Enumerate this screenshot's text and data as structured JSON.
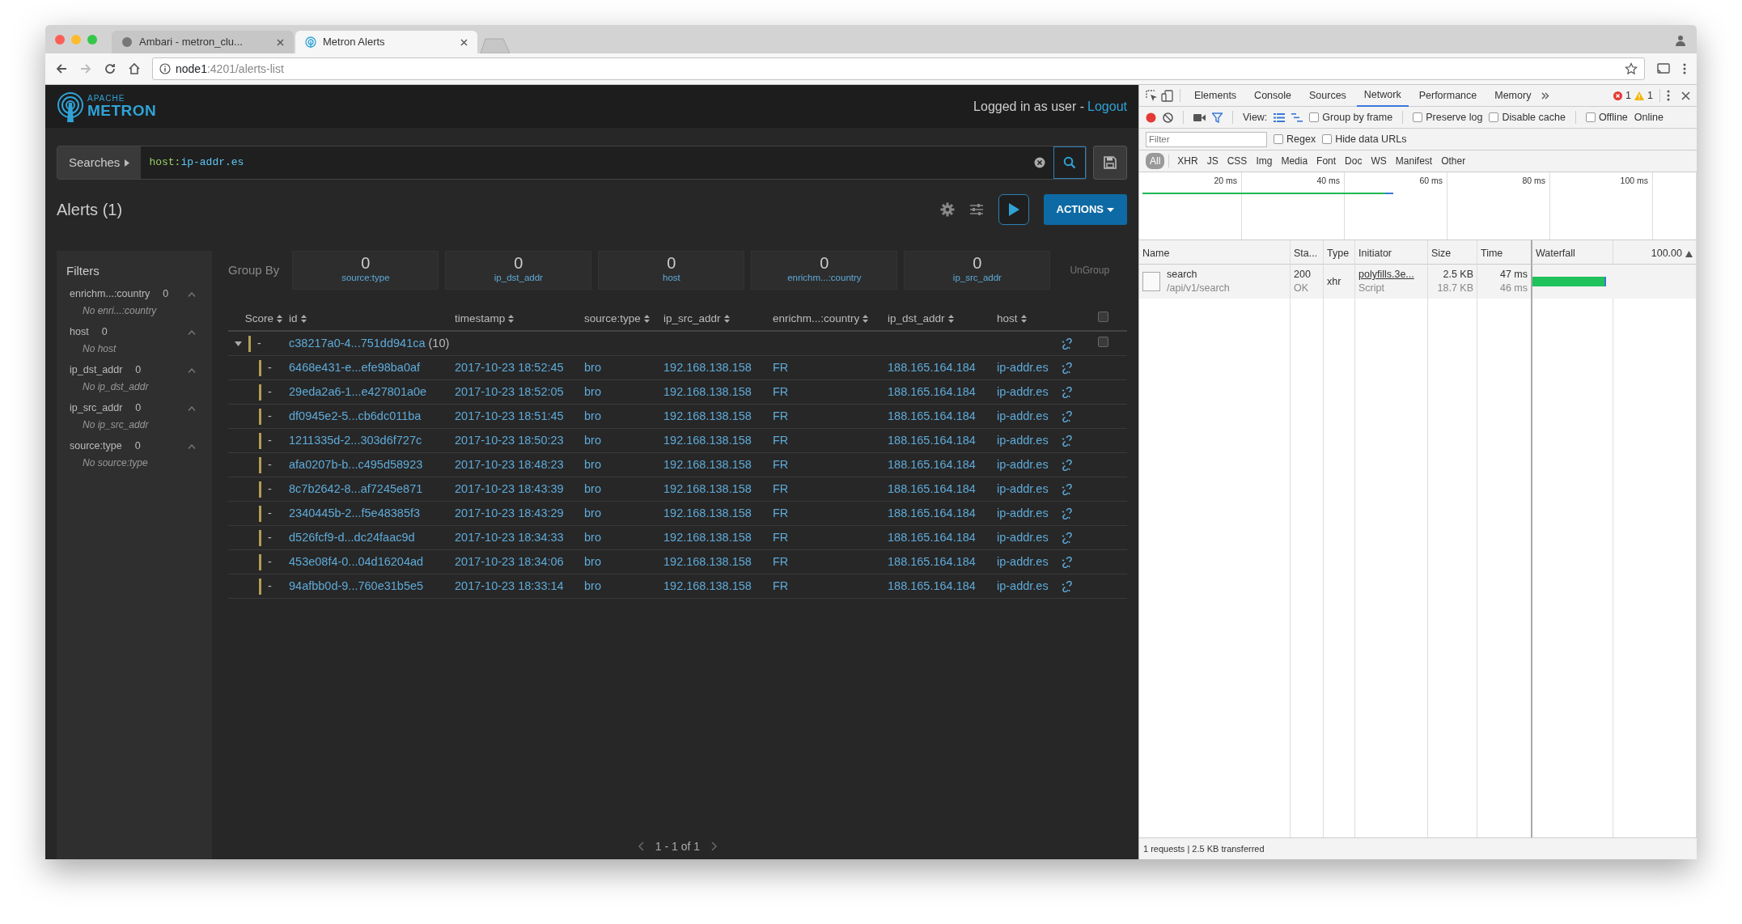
{
  "browser": {
    "tabs": [
      {
        "title": "Ambari - metron_clu...",
        "selected": false
      },
      {
        "title": "Metron Alerts",
        "selected": true
      }
    ],
    "url_host": "node1",
    "url_path": ":4201/alerts-list"
  },
  "app": {
    "logo_small": "APACHE",
    "logo_main": "METRON",
    "login_text": "Logged in as user -",
    "logout": "Logout",
    "searches": "Searches",
    "query_key": "host:",
    "query_value": "ip-addr.es",
    "title": "Alerts (1)",
    "actions": "ACTIONS"
  },
  "filters": {
    "title": "Filters",
    "items": [
      {
        "label": "enrichm...:country",
        "count": "0",
        "empty": "No enri...:country",
        "expanded": true
      },
      {
        "label": "host",
        "count": "0",
        "empty": "No host",
        "expanded": true
      },
      {
        "label": "ip_dst_addr",
        "count": "0",
        "empty": "No ip_dst_addr",
        "expanded": true
      },
      {
        "label": "ip_src_addr",
        "count": "0",
        "empty": "No ip_src_addr",
        "expanded": true
      },
      {
        "label": "source:type",
        "count": "0",
        "empty": "No source:type",
        "expanded": true
      }
    ]
  },
  "group_by": {
    "label": "Group By",
    "items": [
      {
        "count": "0",
        "label": "source:type"
      },
      {
        "count": "0",
        "label": "ip_dst_addr"
      },
      {
        "count": "0",
        "label": "host"
      },
      {
        "count": "0",
        "label": "enrichm...:country"
      },
      {
        "count": "0",
        "label": "ip_src_addr"
      }
    ],
    "ungroup": "UnGroup"
  },
  "table": {
    "columns": [
      "Score",
      "id",
      "timestamp",
      "source:type",
      "ip_src_addr",
      "enrichm...:country",
      "ip_dst_addr",
      "host"
    ],
    "select_all_checked": false,
    "group": {
      "score": "-",
      "id": "c38217a0-4...751dd941ca",
      "count": "(10)",
      "expanded": true,
      "checked": false
    },
    "rows": [
      {
        "score": "-",
        "id": "6468e431-e...efe98ba0af",
        "timestamp": "2017-10-23 18:52:45",
        "source_type": "bro",
        "ip_src_addr": "192.168.138.158",
        "country": "FR",
        "ip_dst_addr": "188.165.164.184",
        "host": "ip-addr.es"
      },
      {
        "score": "-",
        "id": "29eda2a6-1...e427801a0e",
        "timestamp": "2017-10-23 18:52:05",
        "source_type": "bro",
        "ip_src_addr": "192.168.138.158",
        "country": "FR",
        "ip_dst_addr": "188.165.164.184",
        "host": "ip-addr.es"
      },
      {
        "score": "-",
        "id": "df0945e2-5...cb6dc011ba",
        "timestamp": "2017-10-23 18:51:45",
        "source_type": "bro",
        "ip_src_addr": "192.168.138.158",
        "country": "FR",
        "ip_dst_addr": "188.165.164.184",
        "host": "ip-addr.es"
      },
      {
        "score": "-",
        "id": "1211335d-2...303d6f727c",
        "timestamp": "2017-10-23 18:50:23",
        "source_type": "bro",
        "ip_src_addr": "192.168.138.158",
        "country": "FR",
        "ip_dst_addr": "188.165.164.184",
        "host": "ip-addr.es"
      },
      {
        "score": "-",
        "id": "afa0207b-b...c495d58923",
        "timestamp": "2017-10-23 18:48:23",
        "source_type": "bro",
        "ip_src_addr": "192.168.138.158",
        "country": "FR",
        "ip_dst_addr": "188.165.164.184",
        "host": "ip-addr.es"
      },
      {
        "score": "-",
        "id": "8c7b2642-8...af7245e871",
        "timestamp": "2017-10-23 18:43:39",
        "source_type": "bro",
        "ip_src_addr": "192.168.138.158",
        "country": "FR",
        "ip_dst_addr": "188.165.164.184",
        "host": "ip-addr.es"
      },
      {
        "score": "-",
        "id": "2340445b-2...f5e48385f3",
        "timestamp": "2017-10-23 18:43:29",
        "source_type": "bro",
        "ip_src_addr": "192.168.138.158",
        "country": "FR",
        "ip_dst_addr": "188.165.164.184",
        "host": "ip-addr.es"
      },
      {
        "score": "-",
        "id": "d526fcf9-d...dc24faac9d",
        "timestamp": "2017-10-23 18:34:33",
        "source_type": "bro",
        "ip_src_addr": "192.168.138.158",
        "country": "FR",
        "ip_dst_addr": "188.165.164.184",
        "host": "ip-addr.es"
      },
      {
        "score": "-",
        "id": "453e08f4-0...04d16204ad",
        "timestamp": "2017-10-23 18:34:06",
        "source_type": "bro",
        "ip_src_addr": "192.168.138.158",
        "country": "FR",
        "ip_dst_addr": "188.165.164.184",
        "host": "ip-addr.es"
      },
      {
        "score": "-",
        "id": "94afbb0d-9...760e31b5e5",
        "timestamp": "2017-10-23 18:33:14",
        "source_type": "bro",
        "ip_src_addr": "192.168.138.158",
        "country": "FR",
        "ip_dst_addr": "188.165.164.184",
        "host": "ip-addr.es"
      }
    ]
  },
  "pagination": "1 - 1 of 1",
  "devtools": {
    "tabs": [
      {
        "label": "Elements",
        "selected": false
      },
      {
        "label": "Console",
        "selected": false
      },
      {
        "label": "Sources",
        "selected": false
      },
      {
        "label": "Network",
        "selected": true
      },
      {
        "label": "Performance",
        "selected": false
      },
      {
        "label": "Memory",
        "selected": false
      }
    ],
    "errors": "1",
    "warnings": "1",
    "recording": true,
    "filter_active": true,
    "view_label": "View:",
    "large_rows_selected": true,
    "options": [
      {
        "label": "Group by frame",
        "checked": false
      },
      {
        "label": "Preserve log",
        "checked": false
      },
      {
        "label": "Disable cache",
        "checked": false
      },
      {
        "label": "Offline",
        "checked": false
      }
    ],
    "throttling": "Online",
    "filter_placeholder": "Filter",
    "filter_options": [
      {
        "label": "Regex",
        "checked": false
      },
      {
        "label": "Hide data URLs",
        "checked": false
      }
    ],
    "types": [
      {
        "label": "All",
        "selected": true
      },
      {
        "label": "XHR",
        "selected": false
      },
      {
        "label": "JS",
        "selected": false
      },
      {
        "label": "CSS",
        "selected": false
      },
      {
        "label": "Img",
        "selected": false
      },
      {
        "label": "Media",
        "selected": false
      },
      {
        "label": "Font",
        "selected": false
      },
      {
        "label": "Doc",
        "selected": false
      },
      {
        "label": "WS",
        "selected": false
      },
      {
        "label": "Manifest",
        "selected": false
      },
      {
        "label": "Other",
        "selected": false
      }
    ],
    "ticks": [
      "20 ms",
      "40 ms",
      "60 ms",
      "80 ms",
      "100 ms"
    ],
    "columns": [
      "Name",
      "Sta...",
      "Type",
      "Initiator",
      "Size",
      "Time",
      "Waterfall",
      "100.00"
    ],
    "requests": [
      {
        "name": "search",
        "path": "/api/v1/search",
        "status": "200",
        "status_text": "OK",
        "type": "xhr",
        "initiator": "polyfills.3e...",
        "initiator_type": "Script",
        "size": "2.5 KB",
        "resource_size": "18.7 KB",
        "time": "47 ms",
        "latency": "46 ms",
        "level": 0.45
      }
    ],
    "status": "1 requests | 2.5 KB transferred"
  }
}
